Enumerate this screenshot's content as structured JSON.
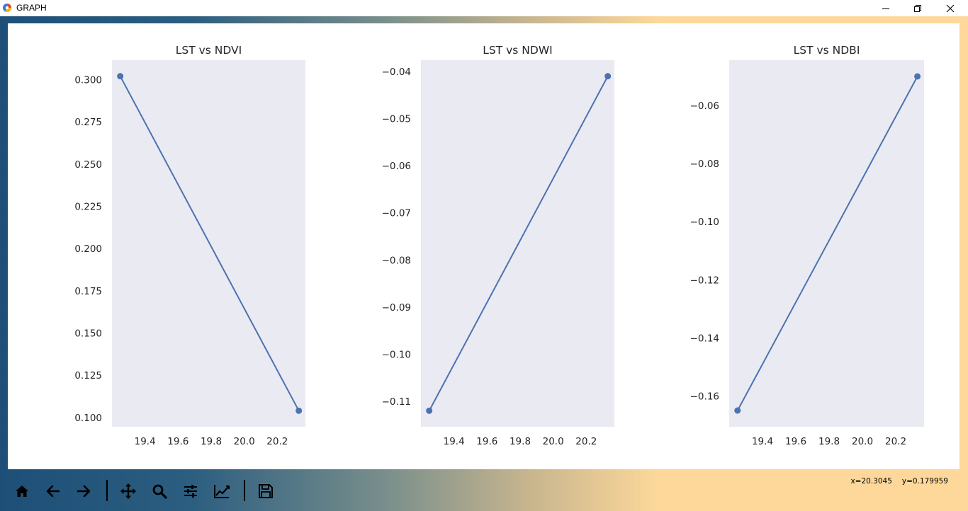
{
  "window": {
    "title": "GRAPH"
  },
  "toolbar": {
    "buttons": [
      {
        "name": "home-icon"
      },
      {
        "name": "back-arrow-icon"
      },
      {
        "name": "forward-arrow-icon"
      },
      {
        "name": "pan-icon"
      },
      {
        "name": "zoom-icon"
      },
      {
        "name": "configure-subplots-icon"
      },
      {
        "name": "edit-axis-icon"
      },
      {
        "name": "save-icon"
      }
    ]
  },
  "status": {
    "x_readout": "x=20.3045",
    "y_readout": "y=0.179959"
  },
  "colors": {
    "line": "#4c72b0",
    "axes_bg": "#eaeaf2"
  },
  "chart_data": [
    {
      "type": "line",
      "title": "LST vs NDVI",
      "x": [
        19.25,
        20.33
      ],
      "y": [
        0.302,
        0.104
      ],
      "xlim": [
        19.2,
        20.37
      ],
      "ylim": [
        0.0945,
        0.3115
      ],
      "xticks": [
        19.4,
        19.6,
        19.8,
        20.0,
        20.2
      ],
      "xtick_labels": [
        "19.4",
        "19.6",
        "19.8",
        "20.0",
        "20.2"
      ],
      "yticks": [
        0.1,
        0.125,
        0.15,
        0.175,
        0.2,
        0.225,
        0.25,
        0.275,
        0.3
      ],
      "ytick_labels": [
        "0.100",
        "0.125",
        "0.150",
        "0.175",
        "0.200",
        "0.225",
        "0.250",
        "0.275",
        "0.300"
      ],
      "grid": false
    },
    {
      "type": "line",
      "title": "LST vs NDWI",
      "x": [
        19.25,
        20.33
      ],
      "y": [
        -0.112,
        -0.041
      ],
      "xlim": [
        19.2,
        20.37
      ],
      "ylim": [
        -0.1154,
        -0.0376
      ],
      "xticks": [
        19.4,
        19.6,
        19.8,
        20.0,
        20.2
      ],
      "xtick_labels": [
        "19.4",
        "19.6",
        "19.8",
        "20.0",
        "20.2"
      ],
      "yticks": [
        -0.11,
        -0.1,
        -0.09,
        -0.08,
        -0.07,
        -0.06,
        -0.05,
        -0.04
      ],
      "ytick_labels": [
        "−0.11",
        "−0.10",
        "−0.09",
        "−0.08",
        "−0.07",
        "−0.06",
        "−0.05",
        "−0.04"
      ],
      "grid": false
    },
    {
      "type": "line",
      "title": "LST vs NDBI",
      "x": [
        19.25,
        20.33
      ],
      "y": [
        -0.165,
        -0.05
      ],
      "xlim": [
        19.2,
        20.37
      ],
      "ylim": [
        -0.1706,
        -0.0444
      ],
      "xticks": [
        19.4,
        19.6,
        19.8,
        20.0,
        20.2
      ],
      "xtick_labels": [
        "19.4",
        "19.6",
        "19.8",
        "20.0",
        "20.2"
      ],
      "yticks": [
        -0.16,
        -0.14,
        -0.12,
        -0.1,
        -0.08,
        -0.06
      ],
      "ytick_labels": [
        "−0.16",
        "−0.14",
        "−0.12",
        "−0.10",
        "−0.08",
        "−0.06"
      ],
      "grid": false
    }
  ]
}
